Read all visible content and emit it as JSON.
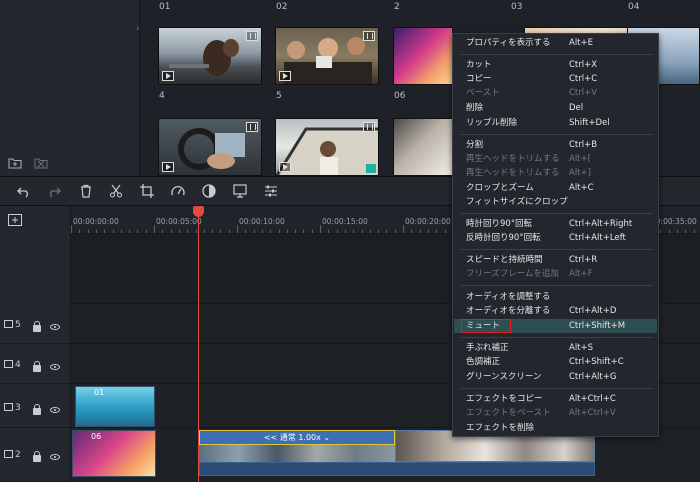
{
  "media": {
    "thumbs": [
      {
        "label": "01"
      },
      {
        "label": "02"
      },
      {
        "label": "2"
      },
      {
        "label": "03"
      },
      {
        "label": "04"
      },
      {
        "label": "4"
      },
      {
        "label": "5"
      },
      {
        "label": "06"
      }
    ],
    "brand_text": "filmo"
  },
  "timeline": {
    "ticks": [
      "00:00:00:00",
      "00:00:05:00",
      "00:00:10:00",
      "00:00:15:00",
      "00:00:20:00",
      "00:00:35:00"
    ],
    "tracks": [
      {
        "number": "5"
      },
      {
        "number": "4"
      },
      {
        "number": "3"
      },
      {
        "number": "2"
      }
    ],
    "clips": [
      {
        "label": "01"
      },
      {
        "label": "06"
      }
    ],
    "speed_label": "<< 通常 1.00x ⌄"
  },
  "context_menu": {
    "items": [
      {
        "label": "プロパティを表示する",
        "shortcut": "Alt+E"
      },
      {
        "label": "カット",
        "shortcut": "Ctrl+X"
      },
      {
        "label": "コピー",
        "shortcut": "Ctrl+C"
      },
      {
        "label": "ペースト",
        "shortcut": "Ctrl+V"
      },
      {
        "label": "削除",
        "shortcut": "Del"
      },
      {
        "label": "リップル削除",
        "shortcut": "Shift+Del"
      },
      {
        "label": "分割",
        "shortcut": "Ctrl+B"
      },
      {
        "label": "再生ヘッドをトリムする",
        "shortcut": "Alt+["
      },
      {
        "label": "再生ヘッドをトリムする",
        "shortcut": "Alt+]"
      },
      {
        "label": "クロップとズーム",
        "shortcut": "Alt+C"
      },
      {
        "label": "フィットサイズにクロップ",
        "shortcut": ""
      },
      {
        "label": "時計回り90°回転",
        "shortcut": "Ctrl+Alt+Right"
      },
      {
        "label": "反時計回り90°回転",
        "shortcut": "Ctrl+Alt+Left"
      },
      {
        "label": "スピードと持続時間",
        "shortcut": "Ctrl+R"
      },
      {
        "label": "フリーズフレームを追加",
        "shortcut": "Alt+F"
      },
      {
        "label": "オーディオを調整する",
        "shortcut": ""
      },
      {
        "label": "オーディオを分離する",
        "shortcut": "Ctrl+Alt+D"
      },
      {
        "label": "ミュート",
        "shortcut": "Ctrl+Shift+M"
      },
      {
        "label": "手ぶれ補正",
        "shortcut": "Alt+S"
      },
      {
        "label": "色調補正",
        "shortcut": "Ctrl+Shift+C"
      },
      {
        "label": "グリーンスクリーン",
        "shortcut": "Ctrl+Alt+G"
      },
      {
        "label": "エフェクトをコピー",
        "shortcut": "Alt+Ctrl+C"
      },
      {
        "label": "エフェクトをペースト",
        "shortcut": "Alt+Ctrl+V"
      },
      {
        "label": "エフェクトを削除",
        "shortcut": ""
      }
    ]
  },
  "colors": {
    "playhead": "#e04a3f",
    "highlight": "#2f4e52",
    "mute_outline": "#e02020",
    "clip_blue": "#3e6fb3",
    "speed_border": "#e3c441"
  }
}
